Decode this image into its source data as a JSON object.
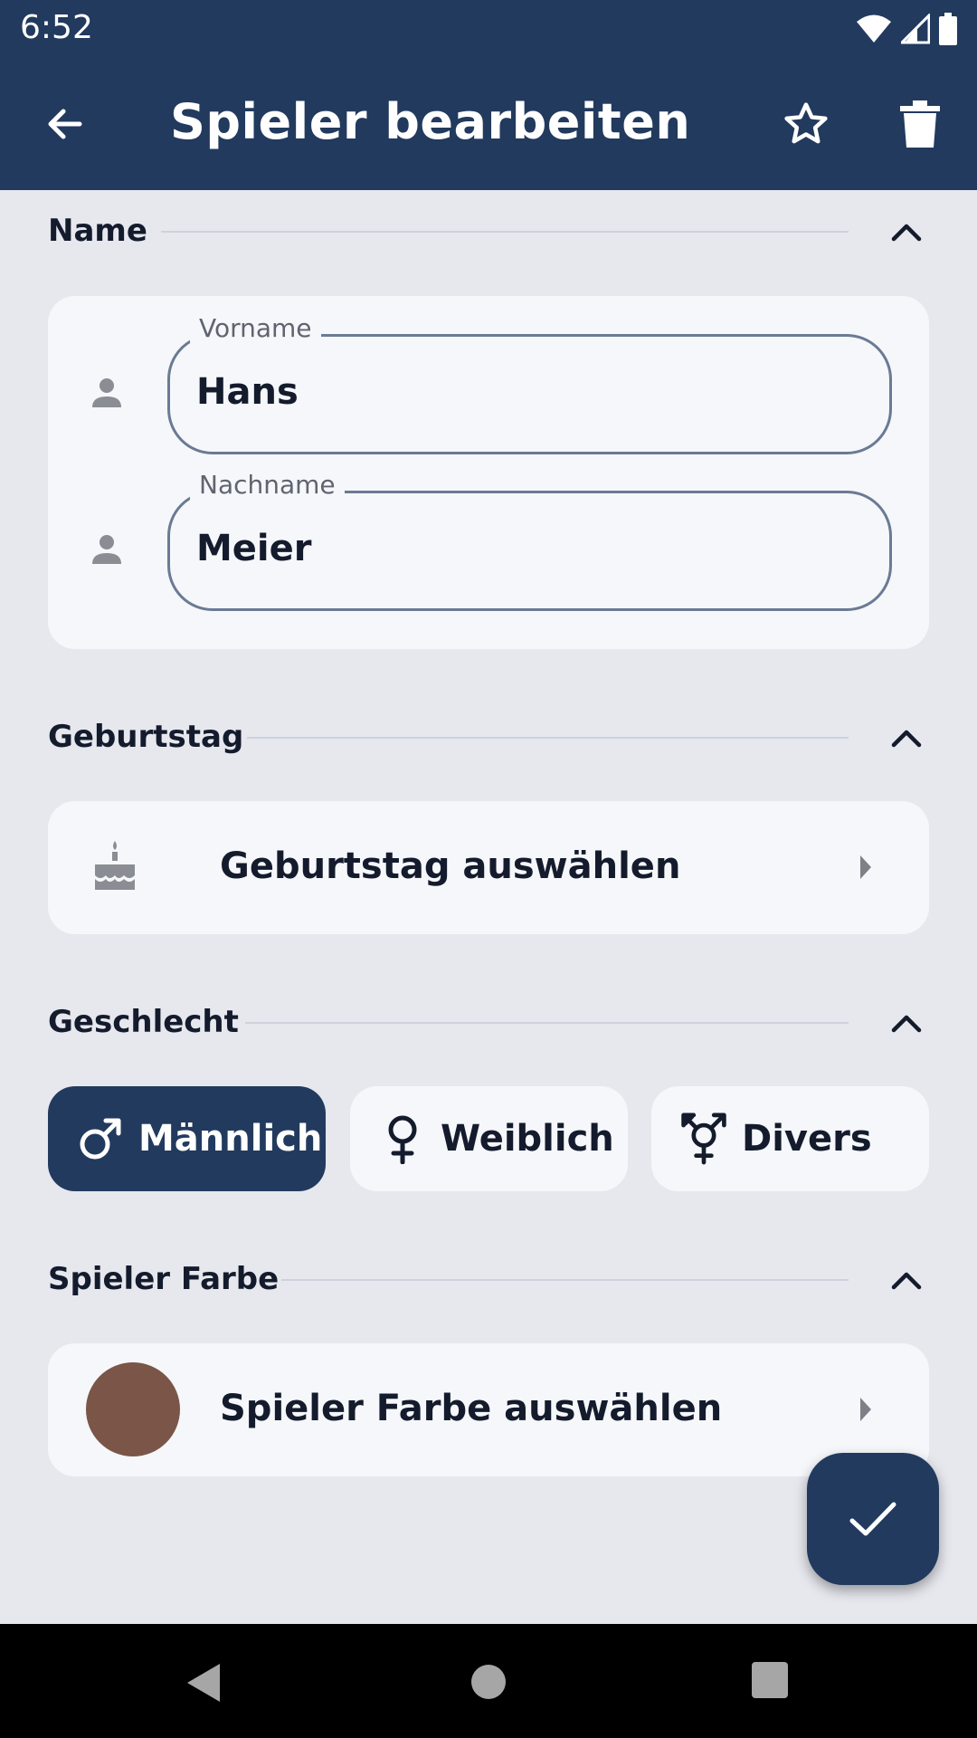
{
  "status_bar": {
    "time": "6:52"
  },
  "app_bar": {
    "title": "Spieler bearbeiten"
  },
  "sections": {
    "name": {
      "label": "Name",
      "fields": {
        "first_name": {
          "label": "Vorname",
          "value": "Hans"
        },
        "last_name": {
          "label": "Nachname",
          "value": "Meier"
        }
      }
    },
    "birthday": {
      "label": "Geburtstag",
      "action": "Geburtstag auswählen"
    },
    "gender": {
      "label": "Geschlecht",
      "options": [
        {
          "label": "Männlich",
          "icon": "male-icon",
          "selected": true
        },
        {
          "label": "Weiblich",
          "icon": "female-icon",
          "selected": false
        },
        {
          "label": "Divers",
          "icon": "transgender-icon",
          "selected": false
        }
      ]
    },
    "color": {
      "label": "Spieler Farbe",
      "action": "Spieler Farbe auswählen",
      "swatch": "#7a5548"
    }
  },
  "colors": {
    "primary": "#223a5e",
    "surface": "#f5f7fa",
    "background": "#e6e8ee"
  }
}
